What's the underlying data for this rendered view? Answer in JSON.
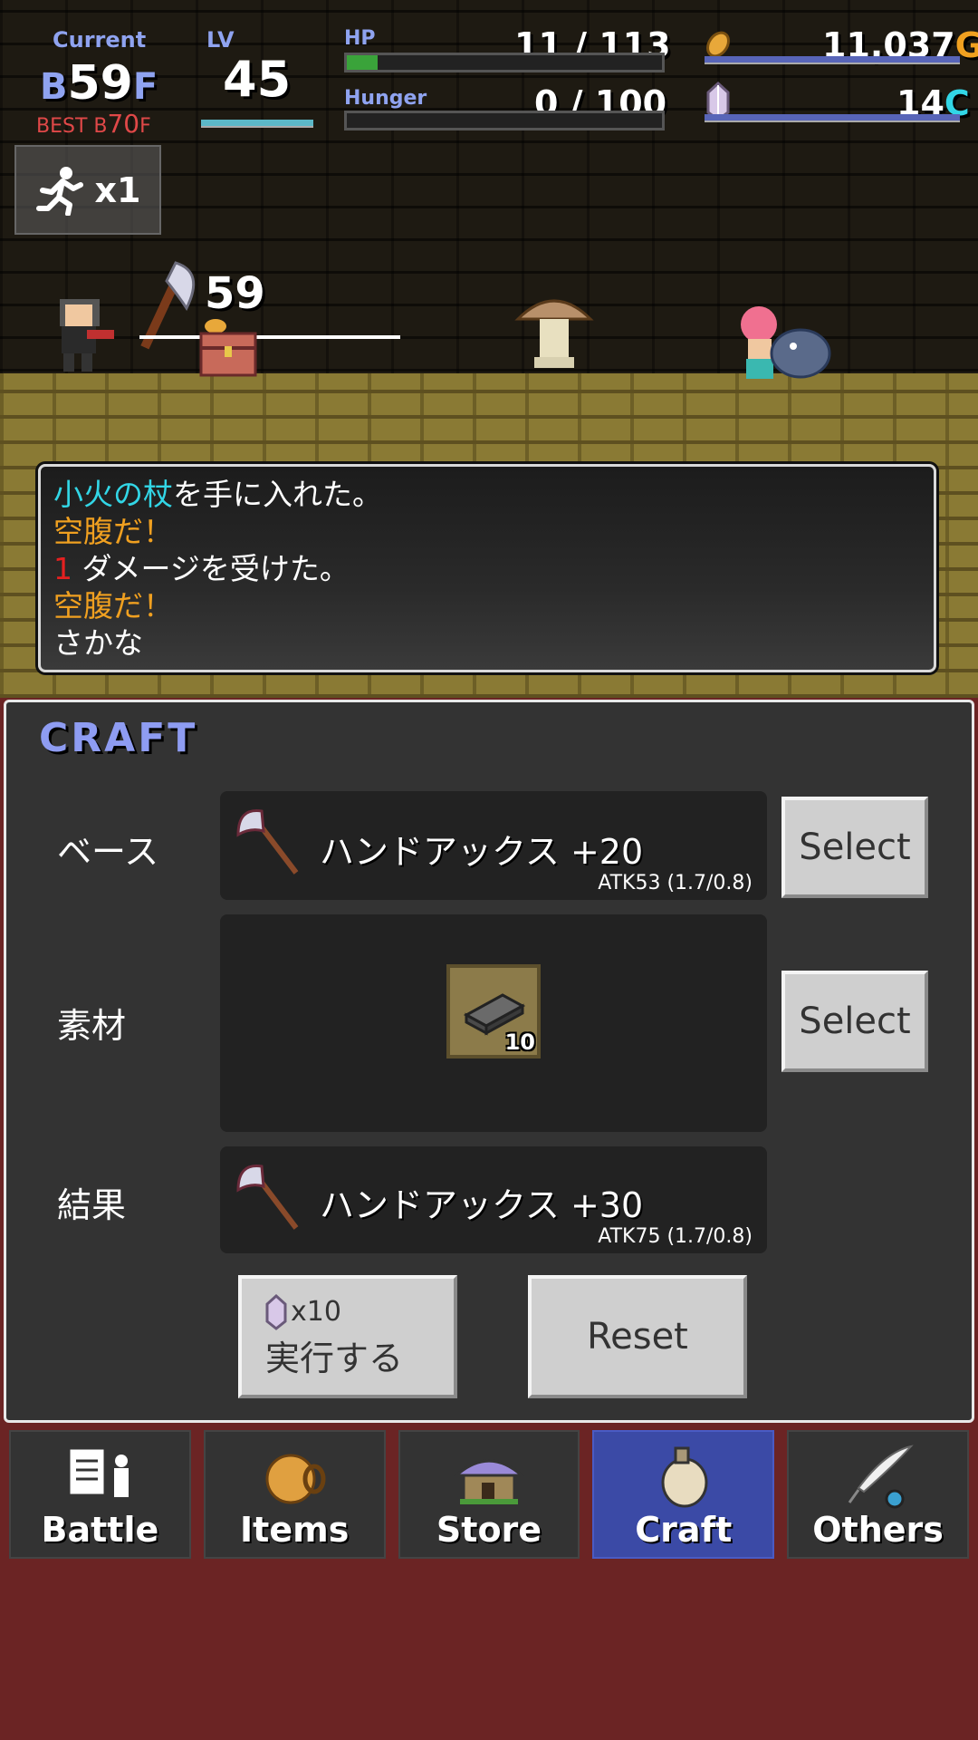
{
  "hud": {
    "current_label": "Current",
    "current_floor_prefix": "B",
    "current_floor_num": "59",
    "current_floor_suffix": "F",
    "best_label": "BEST B",
    "best_floor_num": "70",
    "best_floor_suffix": "F",
    "lv_label": "LV",
    "lv_value": "45",
    "hp_label": "HP",
    "hp_value": "11 / 113",
    "hp_current": 11,
    "hp_max": 113,
    "hunger_label": "Hunger",
    "hunger_value": "0 / 100",
    "hunger_current": 0,
    "hunger_max": 100,
    "gold_value": "11,037",
    "gold_unit": "G",
    "crystal_value": "14",
    "crystal_unit": "C",
    "speed_label": "x1",
    "damage_number": "59"
  },
  "log": [
    {
      "parts": [
        {
          "text": "小火の杖",
          "color": "cyan"
        },
        {
          "text": "を手に入れた。",
          "color": "white"
        }
      ]
    },
    {
      "parts": [
        {
          "text": "空腹だ！",
          "color": "orange"
        }
      ]
    },
    {
      "parts": [
        {
          "text": "1",
          "color": "red"
        },
        {
          "text": " ダメージを受けた。",
          "color": "white"
        }
      ]
    },
    {
      "parts": [
        {
          "text": "空腹だ！",
          "color": "orange"
        }
      ]
    },
    {
      "parts": [
        {
          "text": "さかな",
          "color": "white"
        }
      ]
    }
  ],
  "craft": {
    "title": "CRAFT",
    "base_label": "ベース",
    "base_item_name": "ハンドアックス +20",
    "base_item_stat": "ATK53 (1.7/0.8)",
    "select_label": "Select",
    "material_label": "素材",
    "material_count": "10",
    "result_label": "結果",
    "result_item_name": "ハンドアックス +30",
    "result_item_stat": "ATK75 (1.7/0.8)",
    "execute_cost": "x10",
    "execute_label": "実行する",
    "reset_label": "Reset"
  },
  "nav": {
    "tabs": [
      {
        "label": "Battle",
        "icon": "battle-icon"
      },
      {
        "label": "Items",
        "icon": "items-icon"
      },
      {
        "label": "Store",
        "icon": "store-icon"
      },
      {
        "label": "Craft",
        "icon": "craft-icon",
        "active": true
      },
      {
        "label": "Others",
        "icon": "quill-icon"
      }
    ]
  },
  "colors": {
    "accent_blue": "#8e9cf2",
    "gold": "#f0a020",
    "crystal": "#32d6e6",
    "active_tab": "#3b4aa6",
    "background": "#6b2424"
  }
}
